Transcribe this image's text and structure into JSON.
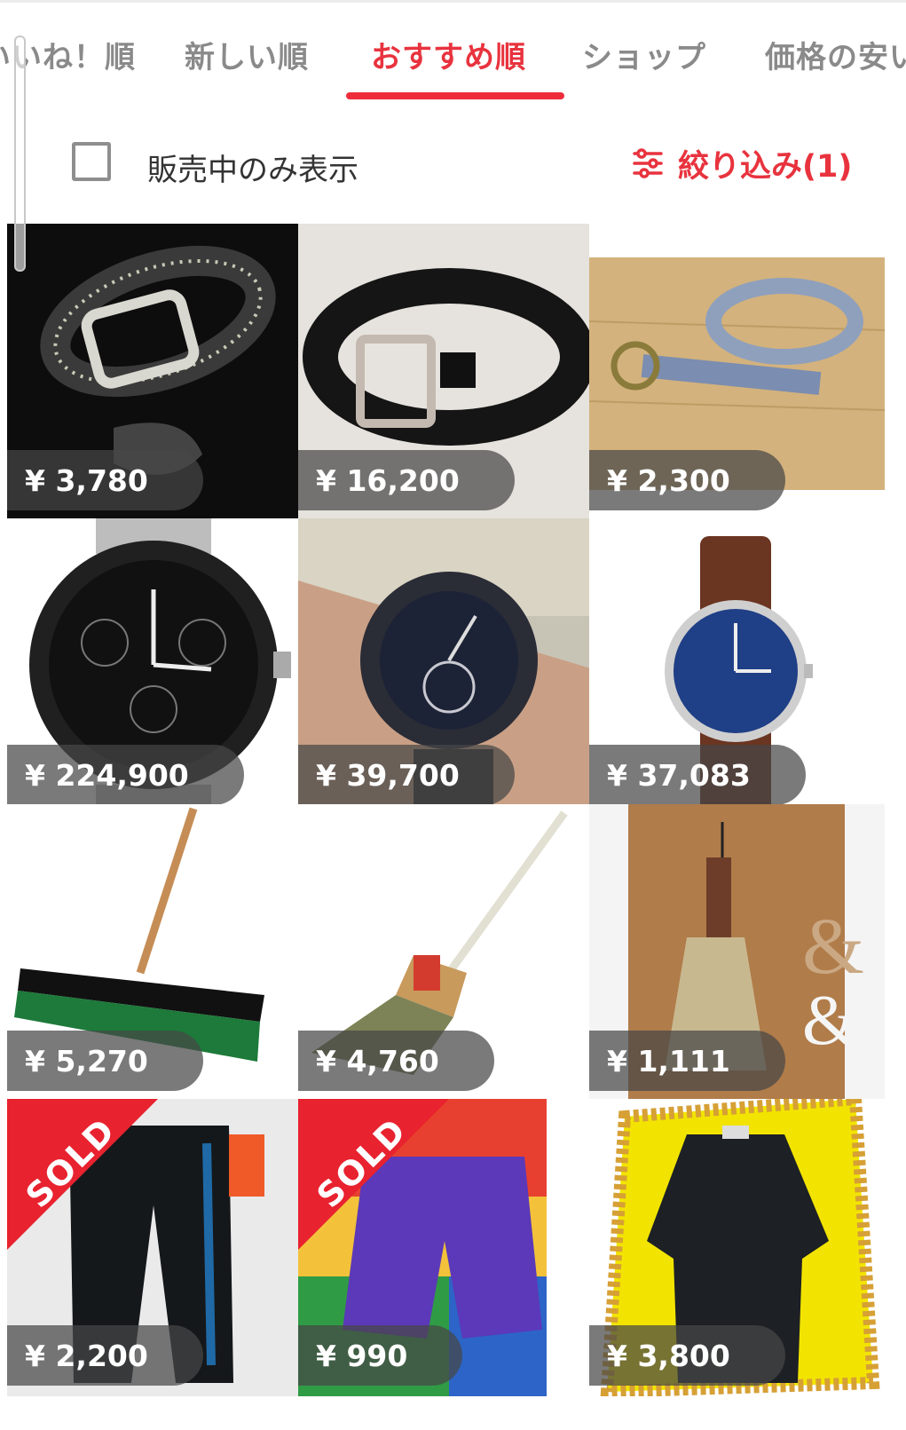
{
  "tabs": [
    {
      "label": "いいね！順"
    },
    {
      "label": "新しい順"
    },
    {
      "label": "おすすめ順",
      "active": true
    },
    {
      "label": "ショップ"
    },
    {
      "label": "価格の安い順"
    }
  ],
  "filter": {
    "on_sale_only_label": "販売中のみ表示",
    "on_sale_only_checked": false,
    "refine_label": "絞り込み(1)"
  },
  "sold_label": "SOLD",
  "items": [
    {
      "price": "¥ 3,780",
      "image": "rhinestone-belt",
      "sold": false
    },
    {
      "price": "¥ 16,200",
      "image": "black-leather-belt",
      "sold": false
    },
    {
      "price": "¥ 2,300",
      "image": "striped-ring-belt",
      "sold": false
    },
    {
      "price": "¥ 224,900",
      "image": "chronograph-watch",
      "sold": false
    },
    {
      "price": "¥ 39,700",
      "image": "wrist-watch-on-arm",
      "sold": false
    },
    {
      "price": "¥ 37,083",
      "image": "blue-dial-brown-strap-watch",
      "sold": false
    },
    {
      "price": "¥ 5,270",
      "image": "push-broom",
      "sold": false
    },
    {
      "price": "¥ 4,760",
      "image": "straw-broom",
      "sold": false
    },
    {
      "price": "¥ 1,111",
      "image": "hand-broom",
      "sold": false
    },
    {
      "price": "¥ 2,200",
      "image": "black-track-pants",
      "sold": true
    },
    {
      "price": "¥ 990",
      "image": "purple-shorts",
      "sold": true
    },
    {
      "price": "¥ 3,800",
      "image": "black-suit",
      "sold": false
    }
  ],
  "colors": {
    "accent": "#e8333e",
    "sold_ribbon": "#e8222f"
  }
}
